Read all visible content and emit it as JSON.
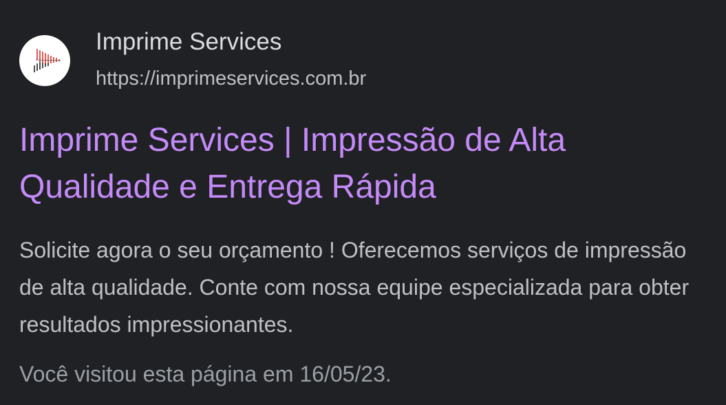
{
  "result": {
    "site_name": "Imprime Services",
    "url": "https://imprimeservices.com.br",
    "title": "Imprime Services | Impressão de Alta Qualidade e Entrega Rápida",
    "snippet": "Solicite agora o seu orçamento ! Oferecemos serviços de impressão de alta qualidade. Conte com nossa equipe especializada para obter resultados impressionantes.",
    "visited_note": "Você visitou esta página em 16/05/23.",
    "favicon": "imprime-services-logo-icon"
  },
  "colors": {
    "background": "#202124",
    "title_link": "#c58af9",
    "site_name": "#dadce0",
    "body_text": "#bdc1c6",
    "visited_text": "#9aa0a6",
    "logo_accent": "#d93025"
  }
}
